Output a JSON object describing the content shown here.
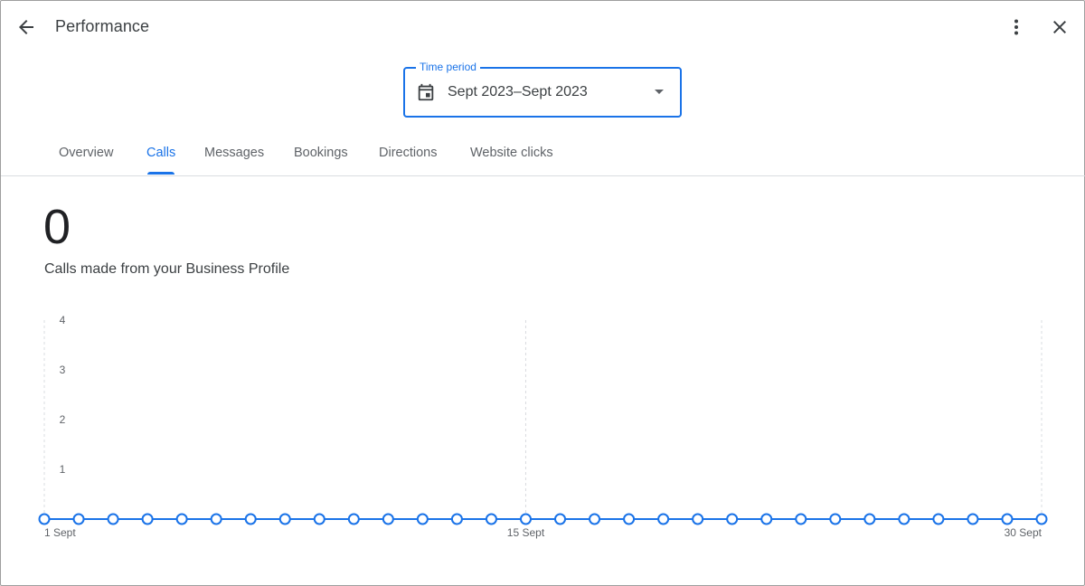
{
  "header": {
    "title": "Performance",
    "back_icon": "arrow-back-icon",
    "more_icon": "more-vert-icon",
    "close_icon": "close-icon"
  },
  "time_period": {
    "label": "Time period",
    "value": "Sept 2023–Sept 2023",
    "icon": "calendar-icon",
    "accent": "#1a73e8"
  },
  "tabs": [
    {
      "label": "Overview",
      "active": false
    },
    {
      "label": "Calls",
      "active": true
    },
    {
      "label": "Messages",
      "active": false
    },
    {
      "label": "Bookings",
      "active": false
    },
    {
      "label": "Directions",
      "active": false
    },
    {
      "label": "Website clicks",
      "active": false
    }
  ],
  "metric": {
    "value": "0",
    "caption": "Calls made from your Business Profile"
  },
  "chart_data": {
    "type": "line",
    "x": [
      "1 Sept",
      "2 Sept",
      "3 Sept",
      "4 Sept",
      "5 Sept",
      "6 Sept",
      "7 Sept",
      "8 Sept",
      "9 Sept",
      "10 Sept",
      "11 Sept",
      "12 Sept",
      "13 Sept",
      "14 Sept",
      "15 Sept",
      "16 Sept",
      "17 Sept",
      "18 Sept",
      "19 Sept",
      "20 Sept",
      "21 Sept",
      "22 Sept",
      "23 Sept",
      "24 Sept",
      "25 Sept",
      "26 Sept",
      "27 Sept",
      "28 Sept",
      "29 Sept",
      "30 Sept"
    ],
    "x_tick_labels": [
      "1 Sept",
      "15 Sept",
      "30 Sept"
    ],
    "series": [
      {
        "values": [
          0,
          0,
          0,
          0,
          0,
          0,
          0,
          0,
          0,
          0,
          0,
          0,
          0,
          0,
          0,
          0,
          0,
          0,
          0,
          0,
          0,
          0,
          0,
          0,
          0,
          0,
          0,
          0,
          0,
          0
        ],
        "color": "#1a73e8"
      }
    ],
    "y_ticks": [
      "1",
      "2",
      "3",
      "4"
    ],
    "ylim": [
      0,
      4
    ],
    "grid": "vertical dashed at 1, 15, 30 Sept"
  }
}
